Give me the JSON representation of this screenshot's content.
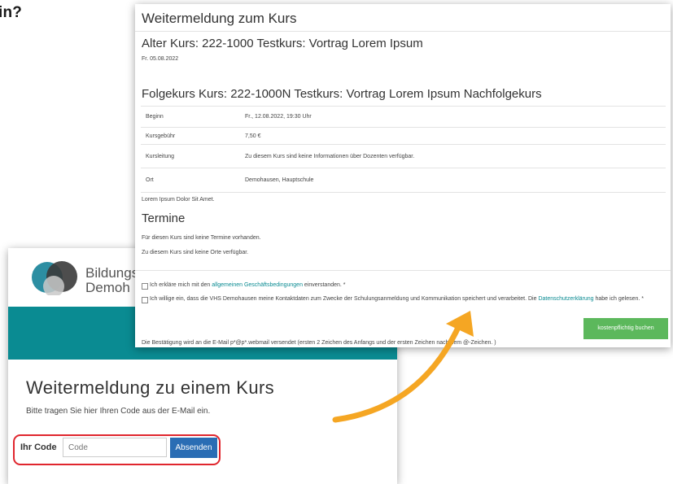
{
  "top_label": "in?",
  "back": {
    "logo_line1": "Bildungs",
    "logo_line2": "Demoh",
    "title": "Weitermeldung zu einem Kurs",
    "subtitle": "Bitte tragen Sie hier Ihren Code aus der E-Mail ein.",
    "code_label": "Ihr Code",
    "code_placeholder": "Code",
    "submit_label": "Absenden"
  },
  "front": {
    "title": "Weitermeldung zum Kurs",
    "old_course": "Alter Kurs: 222-1000 Testkurs: Vortrag Lorem Ipsum",
    "old_date": "Fr. 05.08.2022",
    "follow_course": "Folgekurs Kurs: 222-1000N Testkurs: Vortrag Lorem Ipsum Nachfolgekurs",
    "details": [
      {
        "key": "Beginn",
        "value": "Fr., 12.08.2022, 19:30 Uhr"
      },
      {
        "key": "Kursgebühr",
        "value": "7,50 €"
      },
      {
        "key": "Kursleitung",
        "value": "Zu diesem Kurs sind keine Informationen über Dozenten verfügbar."
      },
      {
        "key": "Ort",
        "value": "Demohausen, Hauptschule"
      }
    ],
    "lorem": "Lorem Ipsum Dolor Sit Amet.",
    "termine_heading": "Termine",
    "no_termine": "Für diesen Kurs sind keine Termine vorhanden.",
    "no_orte": "Zu diesem Kurs sind keine Orte verfügbar.",
    "agb_before": "Ich erkläre mich mit den",
    "agb_link": "allgemeinen Geschäftsbedingungen",
    "agb_after": "einverstanden. *",
    "privacy_before": "Ich willige ein, dass die VHS Demohausen meine Kontaktdaten zum Zwecke der Schulungsanmeldung und Kommunikation speichert und verarbeitet. Die",
    "privacy_link": "Datenschutzerklärung",
    "privacy_after": "habe ich gelesen. *",
    "confirmation": "Die Bestätigung wird an die E-Mail p*@p*.webmail versendet (ersten 2 Zeichen des Anfangs und der ersten Zeichen nach dem @-Zeichen. )",
    "book_label": "kostenpflichtig buchen"
  },
  "colors": {
    "teal": "#0a8b92",
    "button_blue": "#2a6db4",
    "book_green": "#5cb85c",
    "highlight_red": "#e0262e",
    "arrow_orange": "#f5a623"
  }
}
